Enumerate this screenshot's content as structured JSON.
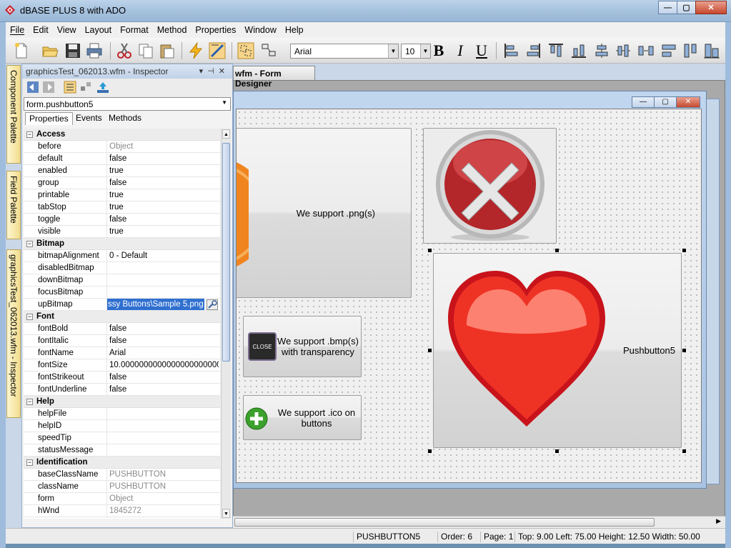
{
  "app": {
    "title": "dBASE PLUS 8 with ADO"
  },
  "window_controls": {
    "minimize": "—",
    "maximize": "▢",
    "close": "✕"
  },
  "menu": [
    "File",
    "Edit",
    "View",
    "Layout",
    "Format",
    "Method",
    "Properties",
    "Window",
    "Help"
  ],
  "toolbar": {
    "font_name": "Arial",
    "font_size": "10",
    "bold": "B",
    "italic": "I",
    "underline": "U"
  },
  "vertical_tabs": [
    "Component Palette",
    "Field Palette",
    "graphicsTest_062013.wfm - Inspector"
  ],
  "designer": {
    "tab_label": "wfm - Form Designer"
  },
  "inspector": {
    "title": "graphicsTest_062013.wfm - Inspector",
    "object": "form.pushbutton5",
    "tabs": [
      "Properties",
      "Events",
      "Methods"
    ],
    "categories": [
      {
        "name": "Access",
        "rows": [
          {
            "k": "before",
            "v": "Object",
            "gray": true
          },
          {
            "k": "default",
            "v": "false"
          },
          {
            "k": "enabled",
            "v": "true"
          },
          {
            "k": "group",
            "v": "false"
          },
          {
            "k": "printable",
            "v": "true"
          },
          {
            "k": "tabStop",
            "v": "true"
          },
          {
            "k": "toggle",
            "v": "false"
          },
          {
            "k": "visible",
            "v": "true"
          }
        ]
      },
      {
        "name": "Bitmap",
        "rows": [
          {
            "k": "bitmapAlignment",
            "v": "0 - Default"
          },
          {
            "k": "disabledBitmap",
            "v": ""
          },
          {
            "k": "downBitmap",
            "v": ""
          },
          {
            "k": "focusBitmap",
            "v": ""
          },
          {
            "k": "upBitmap",
            "v": "ssy Buttons\\Sample 5.png",
            "selected": true
          }
        ]
      },
      {
        "name": "Font",
        "rows": [
          {
            "k": "fontBold",
            "v": "false"
          },
          {
            "k": "fontItalic",
            "v": "false"
          },
          {
            "k": "fontName",
            "v": "Arial"
          },
          {
            "k": "fontSize",
            "v": "10.00000000000000000000000"
          },
          {
            "k": "fontStrikeout",
            "v": "false"
          },
          {
            "k": "fontUnderline",
            "v": "false"
          }
        ]
      },
      {
        "name": "Help",
        "rows": [
          {
            "k": "helpFile",
            "v": ""
          },
          {
            "k": "helpID",
            "v": ""
          },
          {
            "k": "speedTip",
            "v": ""
          },
          {
            "k": "statusMessage",
            "v": ""
          }
        ]
      },
      {
        "name": "Identification",
        "rows": [
          {
            "k": "baseClassName",
            "v": "PUSHBUTTON",
            "gray": true
          },
          {
            "k": "className",
            "v": "PUSHBUTTON",
            "gray": true
          },
          {
            "k": "form",
            "v": "Object",
            "gray": true
          },
          {
            "k": "hWnd",
            "v": "1845272",
            "gray": true
          }
        ]
      }
    ]
  },
  "form": {
    "btn_png": "We support .png(s)",
    "btn_bmp": "We support .bmp(s) with transparency",
    "btn_bmp_icon_text": "CLOSE",
    "btn_ico": "We support .ico on buttons",
    "btn_selected": "Pushbutton5"
  },
  "status": {
    "control": "PUSHBUTTON5",
    "order": "Order: 6",
    "page": "Page: 1",
    "geometry": "Top: 9.00 Left: 75.00 Height: 12.50 Width: 50.00"
  }
}
